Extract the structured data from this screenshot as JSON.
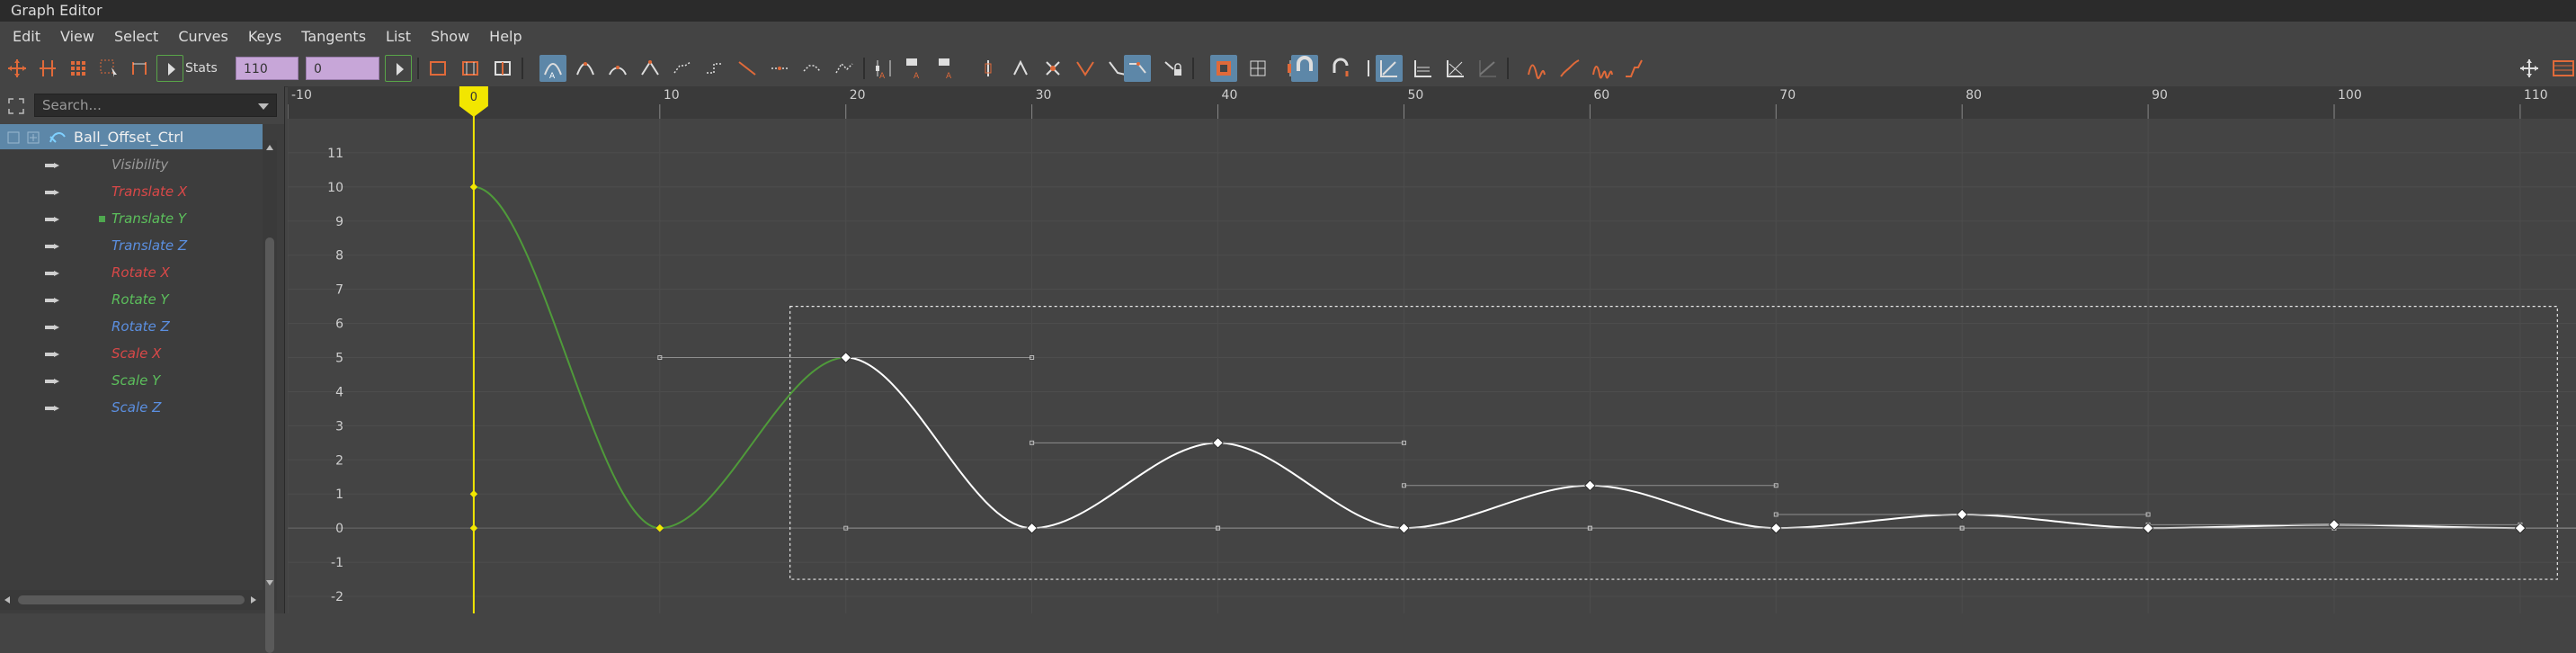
{
  "window": {
    "title": "Graph Editor"
  },
  "menu": [
    "Edit",
    "View",
    "Select",
    "Curves",
    "Keys",
    "Tangents",
    "List",
    "Show",
    "Help"
  ],
  "toolbar": {
    "stats_label": "Stats",
    "stats_field_1": "110",
    "stats_field_2": "0"
  },
  "outliner": {
    "search_placeholder": "Search...",
    "node": "Ball_Offset_Ctrl",
    "attributes": [
      {
        "label": "Visibility",
        "color": "#9a9a9a",
        "keyed": false
      },
      {
        "label": "Translate X",
        "color": "#d94848",
        "keyed": false
      },
      {
        "label": "Translate Y",
        "color": "#5cbf5c",
        "keyed": true
      },
      {
        "label": "Translate Z",
        "color": "#5b8fe0",
        "keyed": false
      },
      {
        "label": "Rotate X",
        "color": "#d94848",
        "keyed": false
      },
      {
        "label": "Rotate Y",
        "color": "#5cbf5c",
        "keyed": false
      },
      {
        "label": "Rotate Z",
        "color": "#5b8fe0",
        "keyed": false
      },
      {
        "label": "Scale X",
        "color": "#d94848",
        "keyed": false
      },
      {
        "label": "Scale Y",
        "color": "#5cbf5c",
        "keyed": false
      },
      {
        "label": "Scale Z",
        "color": "#5b8fe0",
        "keyed": false
      }
    ]
  },
  "graph": {
    "current_frame": "0",
    "frame_ticks": [
      "-10",
      "10",
      "20",
      "30",
      "40",
      "50",
      "60",
      "70",
      "80",
      "90",
      "100",
      "110"
    ],
    "value_ticks": [
      "11",
      "10",
      "9",
      "8",
      "7",
      "6",
      "5",
      "4",
      "3",
      "2",
      "1",
      "0",
      "-1",
      "-2"
    ],
    "x_range": [
      -10,
      113
    ],
    "y_range": [
      -2.5,
      12
    ],
    "keys": [
      {
        "frame": 0,
        "value": 10
      },
      {
        "frame": 10,
        "value": 0
      },
      {
        "frame": 20,
        "value": 5
      },
      {
        "frame": 30,
        "value": 0
      },
      {
        "frame": 40,
        "value": 2.5
      },
      {
        "frame": 50,
        "value": 0
      },
      {
        "frame": 60,
        "value": 1.25
      },
      {
        "frame": 70,
        "value": 0
      },
      {
        "frame": 80,
        "value": 0.4
      },
      {
        "frame": 90,
        "value": 0
      },
      {
        "frame": 100,
        "value": 0.1
      },
      {
        "frame": 110,
        "value": 0
      }
    ],
    "selection_box": {
      "frame_start": 17,
      "frame_end": 112,
      "value_top": 6.5,
      "value_bottom": -1.5
    },
    "colors": {
      "selected_curve": "#ffffff",
      "unselected_curve": "#4f9a3a",
      "time_marker": "#f2e600",
      "grid": "#4d4d4d",
      "zero_line": "#6a6a6a"
    }
  }
}
